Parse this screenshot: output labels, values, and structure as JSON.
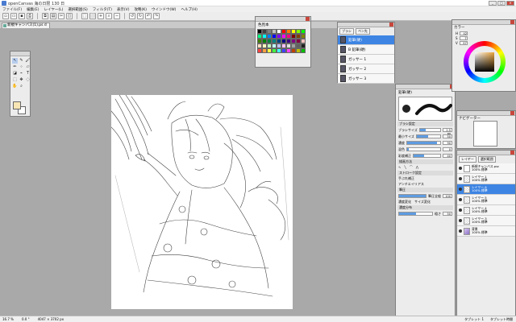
{
  "window": {
    "title": "openCanvas 海の日限 130 日",
    "buttons": {
      "minimize": "_",
      "maximize": "□",
      "close": "×"
    }
  },
  "menubar": {
    "items": [
      "ファイル(F)",
      "編集(E)",
      "レイヤー(L)",
      "選択範囲(S)",
      "フィルタ(T)",
      "表示(V)",
      "攻略(K)",
      "ウインドウ(W)",
      "ヘルプ(H)"
    ]
  },
  "toolbar": {
    "icons": [
      "new-file-icon",
      "open-icon",
      "save-icon",
      "print-icon",
      "copy-icon",
      "paste-icon",
      "select-icon",
      "zoom-icon",
      "rotate-left-icon",
      "rotate-right-icon",
      "undo-icon",
      "redo-icon"
    ]
  },
  "document": {
    "tab_label": "新規キャンバス(1).ps d"
  },
  "palette_panel": {
    "title": "色見本",
    "colors": [
      "#000000",
      "#404040",
      "#808080",
      "#c0c0c0",
      "#ffffff",
      "#ff0000",
      "#ff8000",
      "#ffff00",
      "#80ff00",
      "#00ff00",
      "#00ff80",
      "#00ffff",
      "#0080ff",
      "#0000ff",
      "#8000ff",
      "#ff00ff",
      "#ff0080",
      "#800000",
      "#804000",
      "#808000",
      "#408000",
      "#008000",
      "#008040",
      "#008080",
      "#004080",
      "#000080",
      "#400080",
      "#800080",
      "#800040",
      "#ffc0c0",
      "#ffe0c0",
      "#ffffc0",
      "#c0ffc0",
      "#c0ffff",
      "#c0c0ff",
      "#ffc0ff",
      "#e0e0e0",
      "#a0a0a0",
      "#606060",
      "#202020",
      "#ff4040",
      "#ffa040",
      "#ffff40",
      "#40ff40",
      "#40ffff",
      "#4040ff",
      "#ff40ff",
      "#c04000",
      "#c0c000",
      "#00c000"
    ]
  },
  "brush_panel": {
    "tabs": [
      "ブラシ",
      "ペン先"
    ],
    "items": [
      {
        "label": "鉛筆(硬)"
      },
      {
        "label": "B 鉛筆(硬)"
      },
      {
        "label": "ガッサー 1"
      },
      {
        "label": "ガッサー 2"
      },
      {
        "label": "ガッサー 3"
      }
    ],
    "selected_index": 0
  },
  "brush_props": {
    "name": "鉛筆(硬)",
    "settings_header": "ブラシ設定",
    "props": [
      {
        "label": "ブラシサイズ",
        "value": "2.5 px",
        "fill": 0.3
      },
      {
        "label": "最小サイズ",
        "value": "50",
        "fill": 0.5
      },
      {
        "label": "濃度",
        "value": "90",
        "fill": 0.9
      },
      {
        "label": "混色",
        "value": "0",
        "fill": 0.05
      },
      {
        "label": "彩度補正",
        "value": "40",
        "fill": 0.4
      }
    ],
    "draw_method_header": "描画方法",
    "stroke_header": "ストローク設定",
    "stroke_option": "手ぶれ補正",
    "antialias": "アンチエイリアス",
    "pressure_header": "筆圧",
    "pressure_option": "筆圧全般",
    "pressure_value": "100",
    "checks": [
      "濃度変化",
      "サイズ変化"
    ],
    "texture_header": "濃度分布",
    "texture_label": "粗さ",
    "texture_value": "50"
  },
  "color_panel": {
    "title": "カラー",
    "h_label": "H",
    "h_value": "42",
    "s_label": "S",
    "s_value": "7",
    "v_label": "V",
    "v_value": "97",
    "main_color": "#f7e6b4"
  },
  "nav_panel": {
    "title": "ナビゲーター"
  },
  "layers_panel": {
    "tabs": [
      "レイヤー",
      "選択範囲"
    ],
    "layers": [
      {
        "name": "新規キャンバス.psc",
        "blend": "100% 標準",
        "thumb": "sketch"
      },
      {
        "name": "レイヤー 1",
        "blend": "100% 標準",
        "thumb": "checker"
      },
      {
        "name": "レイヤー 6",
        "blend": "100% 標準",
        "thumb": "checker",
        "selected": true
      },
      {
        "name": "レイヤー 5",
        "blend": "100% 標準",
        "thumb": "checker"
      },
      {
        "name": "レイヤー 4",
        "blend": "100% 標準",
        "thumb": "checker"
      },
      {
        "name": "レイヤー 3",
        "blend": "100% 標準",
        "thumb": "checker"
      },
      {
        "name": "背景",
        "blend": "100% 標準",
        "thumb": "colored"
      }
    ]
  },
  "statusbar": {
    "zoom": "16.7 %",
    "angle": "0.0 °",
    "size": "4047 × 3702 px",
    "tablet1": "タブレット 1",
    "tablet2": "タブレット時間"
  }
}
